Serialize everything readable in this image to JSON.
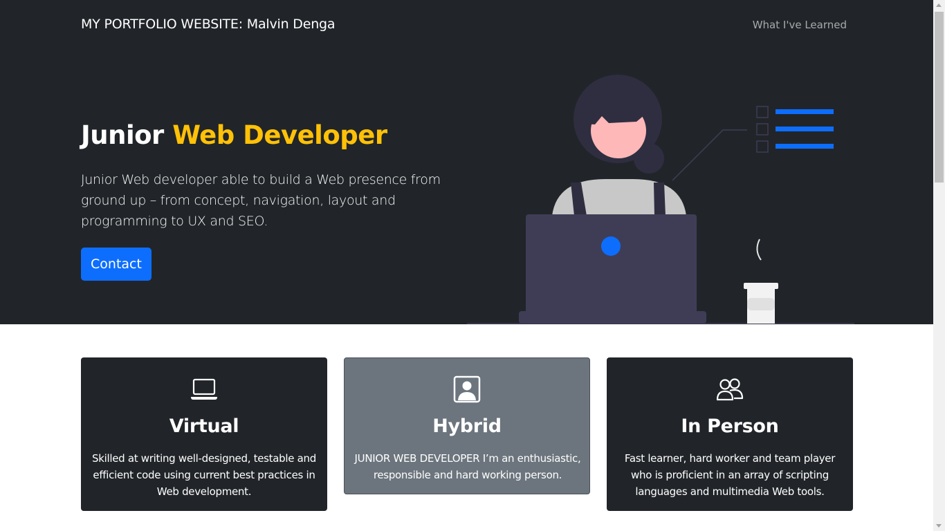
{
  "navbar": {
    "brand": "MY PORTFOLIO WEBSITE: Malvin Denga",
    "link": "What I've Learned"
  },
  "hero": {
    "title_plain": "Junior ",
    "title_accent": "Web Developer",
    "description": "Junior Web developer able to build a Web presence from ground up – from concept, navigation, layout and programming to UX and SEO.",
    "button_label": "Contact"
  },
  "cards": [
    {
      "icon": "laptop-icon",
      "title": "Virtual",
      "text": "Skilled at writing well-designed, testable and efficient code using current best practices in Web development."
    },
    {
      "icon": "person-badge-icon",
      "title": "Hybrid",
      "text": "JUNIOR WEB DEVELOPER I’m an enthusiastic, responsible and hard working person."
    },
    {
      "icon": "people-icon",
      "title": "In Person",
      "text": "Fast learner, hard worker and team player who is proficient in an array of scripting languages and multimedia Web tools."
    }
  ],
  "colors": {
    "dark": "#212529",
    "accent_yellow": "#ffc107",
    "primary_blue": "#0d6efd",
    "card_grey": "#6c757d"
  }
}
